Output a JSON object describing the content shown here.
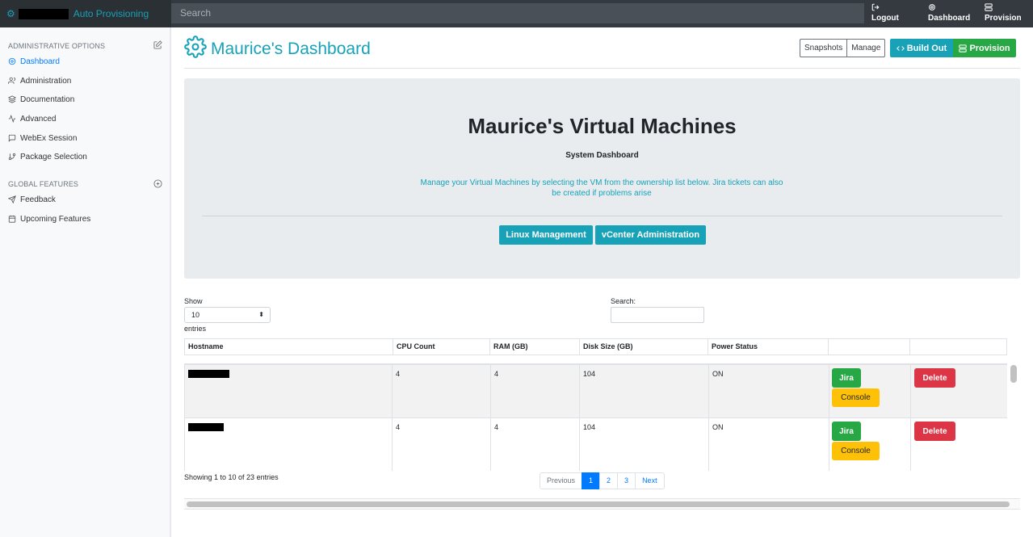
{
  "navbar": {
    "brand": "Auto Provisioning",
    "search_placeholder": "Search",
    "links": [
      {
        "label": "Logout",
        "icon": "logout-icon"
      },
      {
        "label": "Dashboard",
        "icon": "gear-icon"
      },
      {
        "label": "Provision",
        "icon": "server-icon"
      }
    ]
  },
  "sidebar": {
    "section1": "ADMINISTRATIVE OPTIONS",
    "items1": [
      {
        "label": "Dashboard",
        "icon": "settings-icon",
        "active": true
      },
      {
        "label": "Administration",
        "icon": "users-icon"
      },
      {
        "label": "Documentation",
        "icon": "layers-icon"
      },
      {
        "label": "Advanced",
        "icon": "activity-icon"
      },
      {
        "label": "WebEx Session",
        "icon": "message-icon"
      },
      {
        "label": "Package Selection",
        "icon": "git-branch-icon"
      }
    ],
    "section2": "GLOBAL FEATURES",
    "items2": [
      {
        "label": "Feedback",
        "icon": "send-icon"
      },
      {
        "label": "Upcoming Features",
        "icon": "calendar-icon"
      }
    ]
  },
  "header": {
    "title": "Maurice's Dashboard",
    "snapshots": "Snapshots",
    "manage": "Manage",
    "build_out": "Build Out",
    "provision": "Provision"
  },
  "jumbotron": {
    "title": "Maurice's Virtual Machines",
    "subtitle": "System Dashboard",
    "description": "Manage your Virtual Machines by selecting the VM from the ownership list below. Jira tickets can also be created if problems arise",
    "linux_button": "Linux Management",
    "vcenter_button": "vCenter Administration"
  },
  "table_controls": {
    "show_label": "Show",
    "entries_value": "10",
    "entries_label": "entries",
    "search_label": "Search:"
  },
  "table": {
    "columns": [
      "Hostname",
      "CPU Count",
      "RAM (GB)",
      "Disk Size (GB)",
      "Power Status",
      "",
      ""
    ],
    "rows": [
      {
        "cpu": "4",
        "ram": "4",
        "disk": "104",
        "power": "ON",
        "jira": "Jira",
        "console": "Console",
        "delete": "Delete"
      },
      {
        "cpu": "4",
        "ram": "4",
        "disk": "104",
        "power": "ON",
        "jira": "Jira",
        "console": "Console",
        "delete": "Delete"
      }
    ]
  },
  "footer": {
    "info": "Showing 1 to 10 of 23 entries",
    "previous": "Previous",
    "pages": [
      "1",
      "2",
      "3"
    ],
    "next": "Next"
  },
  "colors": {
    "accent": "#17a2b8",
    "success": "#28a745",
    "warning": "#ffc107",
    "danger": "#dc3545",
    "primary": "#007bff"
  }
}
